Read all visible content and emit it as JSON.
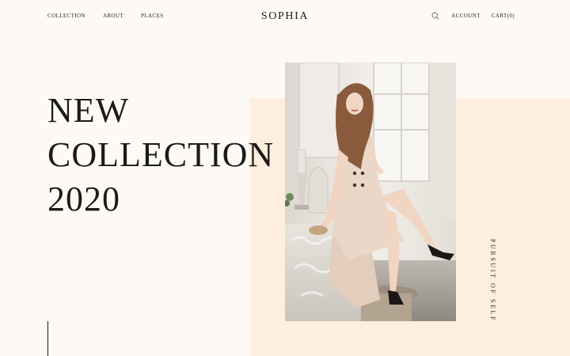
{
  "nav": {
    "left_items": [
      "COLLECTION",
      "ABOUT",
      "PLACES"
    ],
    "account_label": "ACCOUNT",
    "cart_label": "CART",
    "cart_count": "0"
  },
  "brand": {
    "logo": "SOPHIA"
  },
  "hero": {
    "title_lines": [
      "NEW",
      "COLLECTION",
      "2020"
    ],
    "vertical_tagline": "PURSUIT OF SELF"
  },
  "colors": {
    "background": "#fdfaf5",
    "accent_panel": "#fdeedd",
    "text": "#1c1a17"
  },
  "icons": {
    "search": "search-icon"
  }
}
